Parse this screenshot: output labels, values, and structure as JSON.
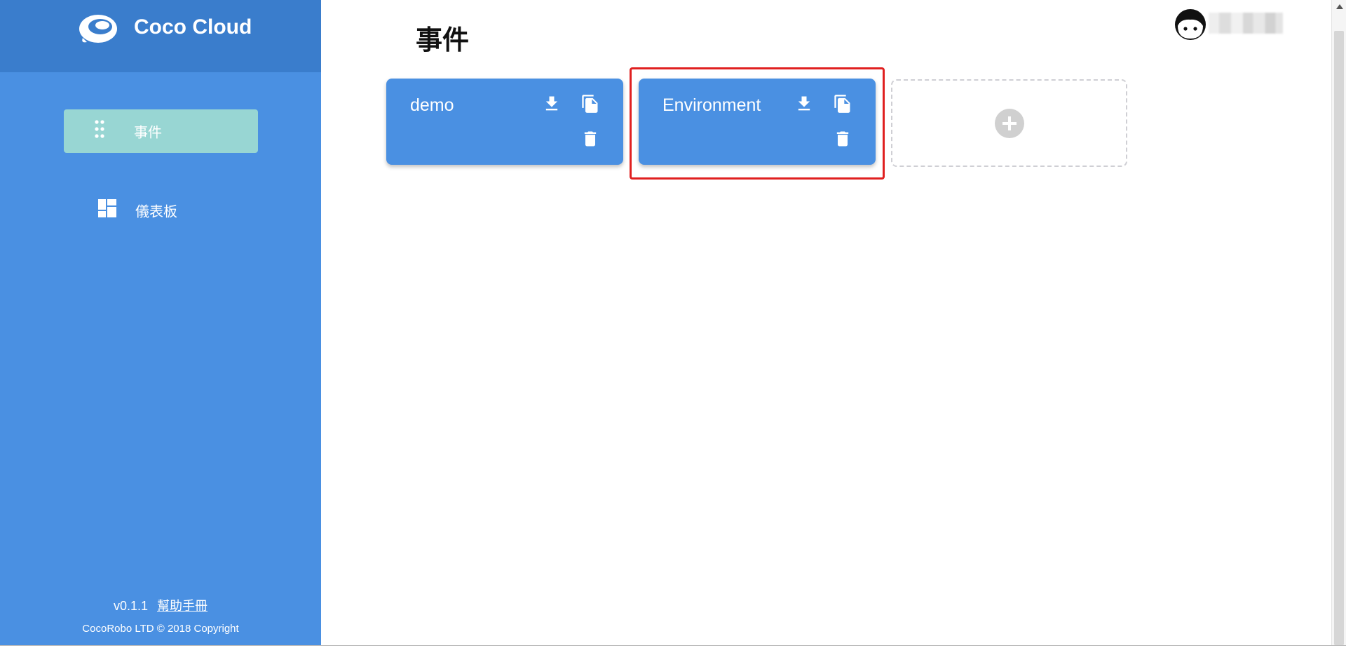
{
  "brand": {
    "name": "Coco Cloud",
    "logo_icon": "cloud-bubble-icon"
  },
  "sidebar": {
    "items": [
      {
        "label": "事件",
        "icon": "drag-dots-icon",
        "active": true
      },
      {
        "label": "儀表板",
        "icon": "dashboard-grid-icon",
        "active": false
      }
    ],
    "footer": {
      "version": "v0.1.1",
      "help_link": "幫助手冊",
      "copyright": "CocoRobo LTD © 2018 Copyright"
    }
  },
  "main": {
    "title": "事件",
    "cards": [
      {
        "name": "demo",
        "actions": [
          "download-icon",
          "copy-icon",
          "delete-icon"
        ],
        "highlighted": false
      },
      {
        "name": "Environment",
        "actions": [
          "download-icon",
          "copy-icon",
          "delete-icon"
        ],
        "highlighted": true
      }
    ],
    "add_card_icon": "plus-circle-icon"
  },
  "user": {
    "avatar_icon": "user-face-icon"
  },
  "colors": {
    "sidebar": "#4a90e2",
    "sidebar_header": "#3a7dcc",
    "active_item": "#98d6d3",
    "card": "#4a90e2",
    "highlight": "#e02020"
  }
}
